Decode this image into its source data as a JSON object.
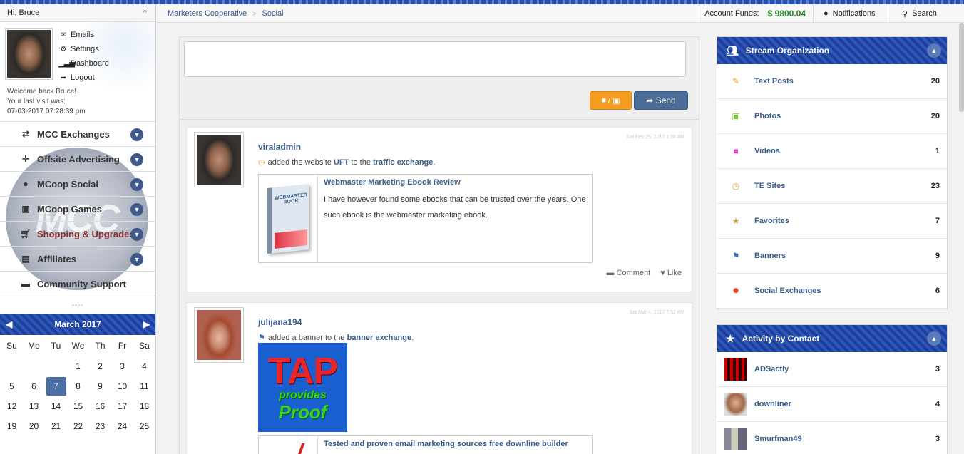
{
  "sidebar": {
    "greeting": "Hi, Bruce",
    "user_menu": [
      {
        "label": "Emails",
        "icon": "envelope-icon"
      },
      {
        "label": "Settings",
        "icon": "gear-icon"
      },
      {
        "label": "Dashboard",
        "icon": "bar-chart-icon"
      },
      {
        "label": "Logout",
        "icon": "logout-icon"
      }
    ],
    "welcome_line1": "Welcome back Bruce!",
    "welcome_line2": "Your last visit was:",
    "welcome_line3": "07-03-2017 07:28:39 pm",
    "logo_text": "MCC",
    "nav": [
      {
        "label": "MCC Exchanges",
        "icon": "retweet-icon"
      },
      {
        "label": "Offsite Advertising",
        "icon": "crosshair-icon"
      },
      {
        "label": "MCoop Social",
        "icon": "user-icon"
      },
      {
        "label": "MCoop Games",
        "icon": "gift-icon"
      },
      {
        "label": "Shopping & Upgrades",
        "icon": "cart-icon"
      },
      {
        "label": "Affiliates",
        "icon": "file-icon"
      },
      {
        "label": "Community Support",
        "icon": "comment-icon"
      }
    ],
    "calendar": {
      "month": "March 2017",
      "dow": [
        "Su",
        "Mo",
        "Tu",
        "We",
        "Th",
        "Fr",
        "Sa"
      ],
      "rows": [
        [
          "",
          "",
          "",
          "1",
          "2",
          "3",
          "4"
        ],
        [
          "5",
          "6",
          "7",
          "8",
          "9",
          "10",
          "11"
        ],
        [
          "12",
          "13",
          "14",
          "15",
          "16",
          "17",
          "18"
        ],
        [
          "19",
          "20",
          "21",
          "22",
          "23",
          "24",
          "25"
        ]
      ],
      "today": "7"
    }
  },
  "topbar": {
    "breadcrumb": [
      "Marketers Cooperative",
      "Social"
    ],
    "funds_label": "Account Funds:",
    "funds_value": "$ 9800.04",
    "notifications": "Notifications",
    "search": "Search"
  },
  "composer": {
    "placeholder": "",
    "media_label": "/",
    "send_label": "Send"
  },
  "posts": [
    {
      "user": "viraladmin",
      "time": "Sat Feb 25, 2017 1:36 AM",
      "action_prefix": "added the website",
      "action_item": "UFT",
      "action_mid": "to the",
      "action_target": "traffic exchange",
      "link_title": "Webmaster Marketing Ebook Review",
      "link_desc": "I have however found some ebooks that can be trusted over the years. One such ebook is the webmaster marketing ebook.",
      "thumb_text": "WEBMASTER BOOK",
      "comment_label": "Comment",
      "like_label": "Like"
    },
    {
      "user": "julijana194",
      "time": "Sat Mar 4, 2017 7:52 AM",
      "action_prefix": "added a banner to the",
      "action_target": "banner exchange",
      "banner_line1": "TAP",
      "banner_line2": "provides",
      "banner_line3": "Proof",
      "link_title": "Tested and proven email marketing sources free downline builder"
    }
  ],
  "stream_org": {
    "title": "Stream Organization",
    "rows": [
      {
        "label": "Text Posts",
        "count": "20",
        "icon": "pencil-icon",
        "color": "#f39c1f"
      },
      {
        "label": "Photos",
        "count": "20",
        "icon": "image-icon",
        "color": "#7ac142"
      },
      {
        "label": "Videos",
        "count": "1",
        "icon": "video-icon",
        "color": "#e040c0"
      },
      {
        "label": "TE Sites",
        "count": "23",
        "icon": "clock-icon",
        "color": "#d8a040"
      },
      {
        "label": "Favorites",
        "count": "7",
        "icon": "star-icon",
        "color": "#c8a050"
      },
      {
        "label": "Banners",
        "count": "9",
        "icon": "flag-icon",
        "color": "#3a6ab0"
      },
      {
        "label": "Social Exchanges",
        "count": "6",
        "icon": "fire-icon",
        "color": "#e04020"
      }
    ]
  },
  "activity": {
    "title": "Activity by Contact",
    "rows": [
      {
        "label": "ADSactly",
        "count": "3"
      },
      {
        "label": "downliner",
        "count": "4"
      },
      {
        "label": "Smurfman49",
        "count": "3"
      }
    ]
  }
}
